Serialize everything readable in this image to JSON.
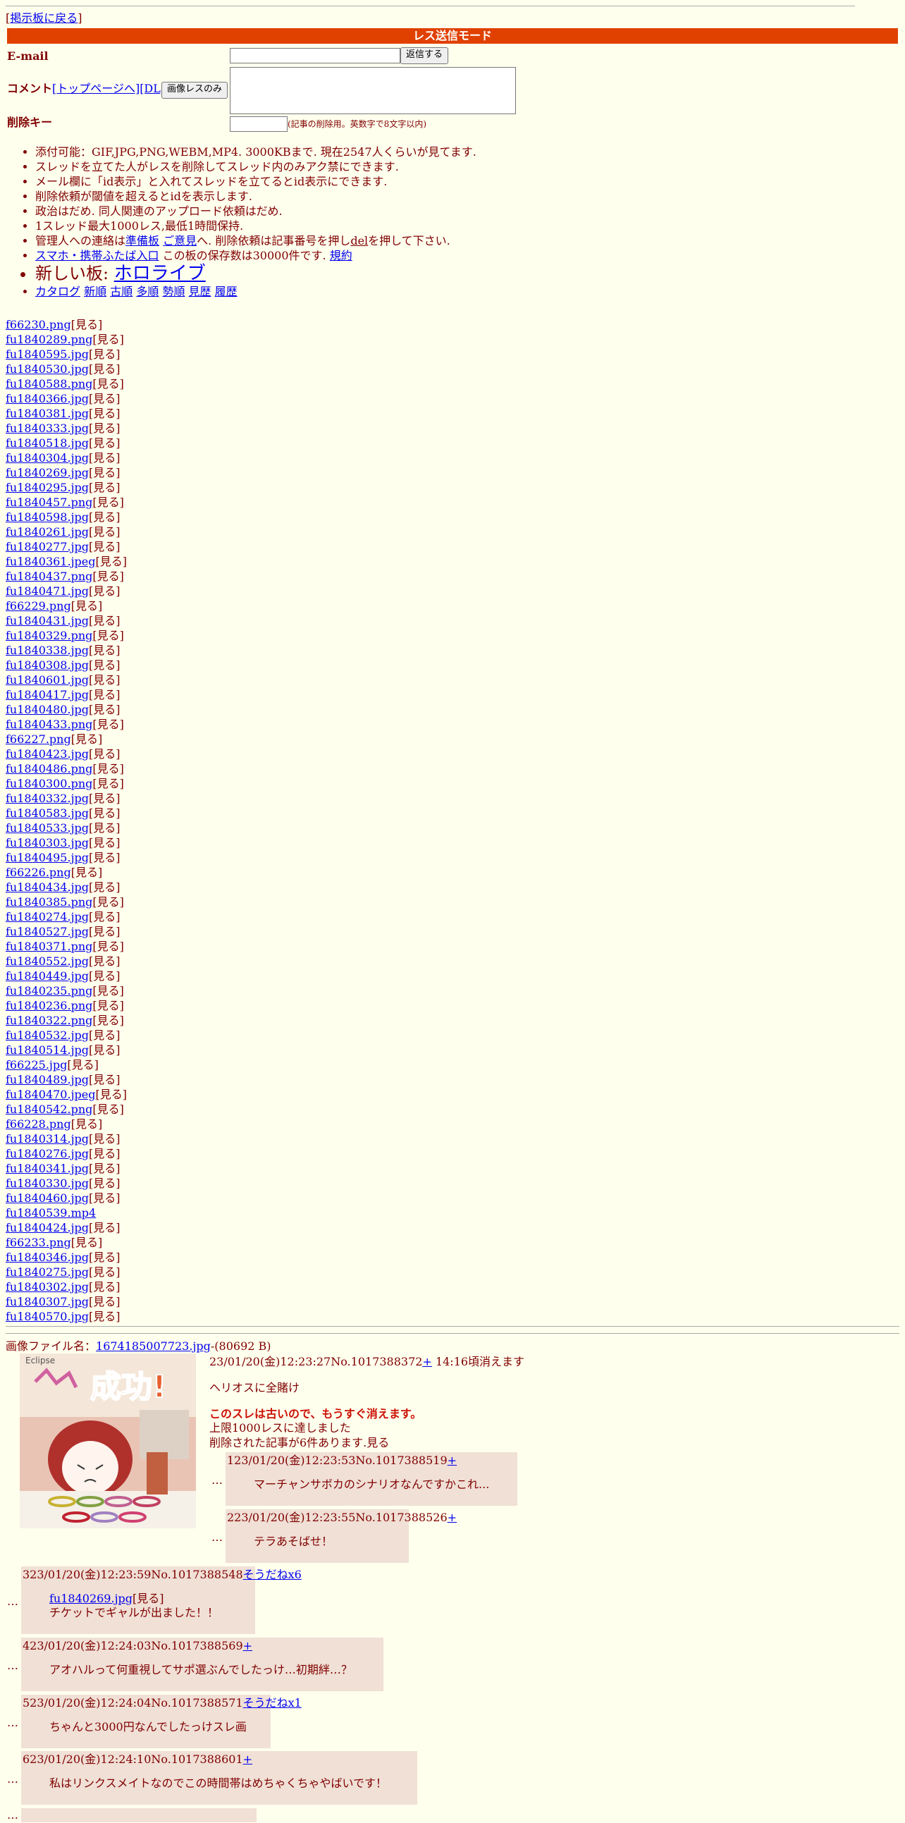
{
  "nav": {
    "back_bracket_l": "[",
    "back_label": "掲示板に戻る",
    "back_bracket_r": "]"
  },
  "mode_title": "レス送信モード",
  "form": {
    "email_label": "E-mail",
    "submit_label": "返信する",
    "comment_label": "コメント",
    "toppage_link": "[トップページへ]",
    "dl_link": "[DL]",
    "image_only_label": "画像レスのみ",
    "delkey_label": "削除キー",
    "delkey_note": "(記事の削除用。英数字で8文字以内)"
  },
  "rules": [
    {
      "text": "添付可能：GIF,JPG,PNG,WEBM,MP4. 3000KBまで. 現在2547人くらいが見てます."
    },
    {
      "text": "スレッドを立てた人がレスを削除してスレッド内のみアク禁にできます."
    },
    {
      "text": "メール欄に「id表示」と入れてスレッドを立てるとid表示にできます."
    },
    {
      "text": "削除依頼が閾値を超えるとidを表示します."
    },
    {
      "text": "政治はだめ. 同人関連のアップロード依頼はだめ."
    },
    {
      "text": "1スレッド最大1000レス,最低1時間保持."
    }
  ],
  "rule_admin": {
    "pre": "管理人への連絡は",
    "link1": "準備板",
    "mid1": " ",
    "link2": "ご意見",
    "mid2": "へ. 削除依頼は記事番号を押し",
    "del": "del",
    "post": "を押して下さい."
  },
  "rule_mobile": {
    "link": "スマホ・携帯ふたば入口",
    "mid": " この板の保存数は30000件です. ",
    "link2": "規約"
  },
  "new_board": {
    "label": "新しい板: ",
    "link": "ホロライブ"
  },
  "sort_links": [
    "カタログ",
    "新順",
    "古順",
    "多順",
    "勢順",
    "見歴",
    "履歴"
  ],
  "view_label": "[見る]",
  "files": [
    "f66230.png",
    "fu1840289.png",
    "fu1840595.jpg",
    "fu1840530.jpg",
    "fu1840588.png",
    "fu1840366.jpg",
    "fu1840381.jpg",
    "fu1840333.jpg",
    "fu1840518.jpg",
    "fu1840304.jpg",
    "fu1840269.jpg",
    "fu1840295.jpg",
    "fu1840457.png",
    "fu1840598.jpg",
    "fu1840261.jpg",
    "fu1840277.jpg",
    "fu1840361.jpeg",
    "fu1840437.png",
    "fu1840471.jpg",
    "f66229.png",
    "fu1840431.jpg",
    "fu1840329.png",
    "fu1840338.jpg",
    "fu1840308.jpg",
    "fu1840601.jpg",
    "fu1840417.jpg",
    "fu1840480.jpg",
    "fu1840433.png",
    "f66227.png",
    "fu1840423.jpg",
    "fu1840486.png",
    "fu1840300.png",
    "fu1840332.jpg",
    "fu1840583.jpg",
    "fu1840533.jpg",
    "fu1840303.jpg",
    "fu1840495.jpg",
    "f66226.png",
    "fu1840434.jpg",
    "fu1840385.png",
    "fu1840274.jpg",
    "fu1840527.jpg",
    "fu1840371.png",
    "fu1840552.jpg",
    "fu1840449.jpg",
    "fu1840235.png",
    "fu1840236.png",
    "fu1840322.png",
    "fu1840532.jpg",
    "fu1840514.jpg",
    "f66225.jpg",
    "fu1840489.jpg",
    "fu1840470.jpeg",
    "fu1840542.png",
    "f66228.png",
    "fu1840314.jpg",
    "fu1840276.jpg",
    "fu1840341.jpg",
    "fu1840330.jpg",
    "fu1840460.jpg",
    "fu1840539.mp4",
    "fu1840424.jpg",
    "f66233.png",
    "fu1840346.jpg",
    "fu1840275.jpg",
    "fu1840302.jpg",
    "fu1840307.jpg",
    "fu1840570.jpg"
  ],
  "no_view_files": [
    "fu1840539.mp4"
  ],
  "op": {
    "file_label": "画像ファイル名：",
    "file_link": "1674185007723.jpg",
    "file_size": "-(80692 B)",
    "thumb_text1": "成功!",
    "thumb_text2": "Eclipse",
    "header": "23/01/20(金)12:23:27No.1017388372",
    "plus": "+",
    "expire": " 14:16頃消えます",
    "comment": "ヘリオスに全賭け",
    "old_notice": "このスレは古いので、もうすぐ消えます。",
    "limit_notice": "上限1000レスに達しました",
    "deleted_notice": "削除された記事が6件あります.見る"
  },
  "replies": [
    {
      "header": "123/01/20(金)12:23:53No.1017388519",
      "link": "+",
      "body": "マーチャンサボカのシナリオなんですかこれ..."
    },
    {
      "header": "223/01/20(金)12:23:55No.1017388526",
      "link": "+",
      "body": "テラあそばせ！"
    },
    {
      "header": "323/01/20(金)12:23:59No.1017388548",
      "link": "そうだねx6",
      "quote_file": "fu1840269.jpg",
      "quote_view": "[見る]",
      "body": "チケットでギャルが出ました！！"
    },
    {
      "header": "423/01/20(金)12:24:03No.1017388569",
      "link": "+",
      "body": "アオハルって何重視してサポ選ぶんでしたっけ…初期絆…？"
    },
    {
      "header": "523/01/20(金)12:24:04No.1017388571",
      "link": "そうだねx1",
      "body": "ちゃんと3000円なんでしたっけスレ画"
    },
    {
      "header": "623/01/20(金)12:24:10No.1017388601",
      "link": "+",
      "body": "私はリンクスメイトなのでこの時間帯はめちゃくちゃやばいです！"
    }
  ],
  "ellipsis": "…"
}
